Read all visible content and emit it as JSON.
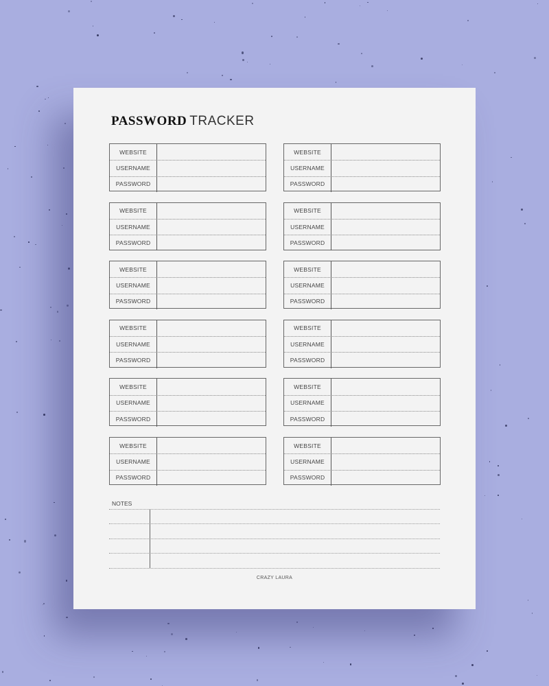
{
  "document": {
    "title_bold": "PASSWORD",
    "title_light": "TRACKER",
    "field_labels": [
      "WEBSITE",
      "USERNAME",
      "PASSWORD"
    ],
    "entries_per_column": 6,
    "columns": 2,
    "notes_label": "NOTES",
    "footer": "CRAZY LAURA"
  },
  "colors": {
    "background": "#a9aee0",
    "page": "#f3f3f3",
    "ink": "#111111"
  }
}
